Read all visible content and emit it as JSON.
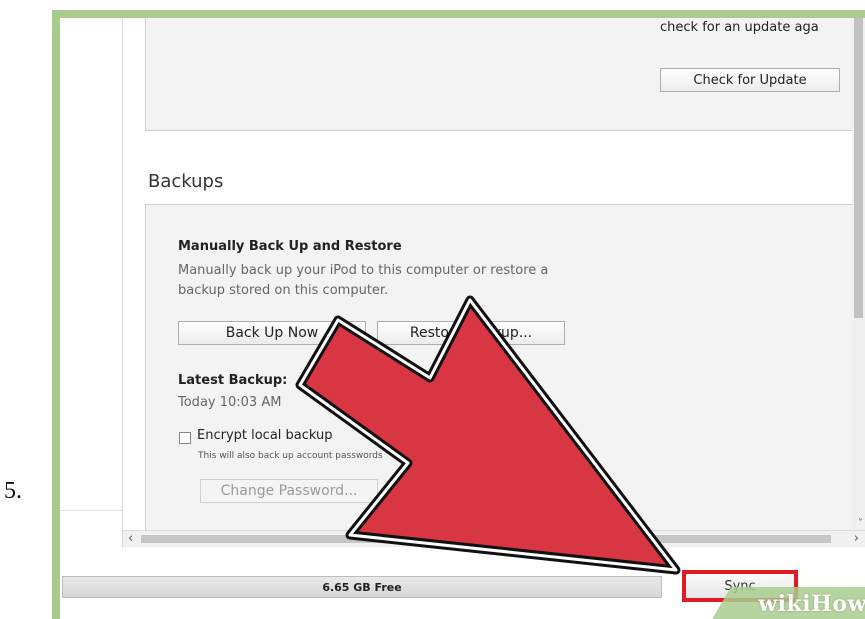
{
  "step": {
    "number": "5."
  },
  "update": {
    "text_partial": "check for an update aga",
    "check_button": "Check for Update"
  },
  "backups": {
    "section_title": "Backups",
    "manual": {
      "heading": "Manually Back Up and Restore",
      "description_line1": "Manually back up your iPod to this computer or restore a",
      "description_line2": "backup stored on this computer.",
      "back_up_now": "Back Up Now",
      "restore_backup": "Restore Backup..."
    },
    "latest": {
      "label": "Latest Backup:",
      "value": "Today 10:03 AM"
    },
    "encrypt": {
      "label": "Encrypt local backup",
      "note": "This will also back up account passwords",
      "checked": false,
      "change_password": "Change Password..."
    }
  },
  "scrollbars": {
    "left_arrow": "‹",
    "right_arrow": "›",
    "down_arrow": "˅"
  },
  "bottom": {
    "capacity_free": "6.65 GB Free",
    "sync_label": "Sync"
  },
  "watermark": {
    "text": "wikiHow"
  },
  "colors": {
    "frame_green": "#a9cc8e",
    "arrow_red": "#d93644",
    "highlight_red": "#e01b24"
  }
}
